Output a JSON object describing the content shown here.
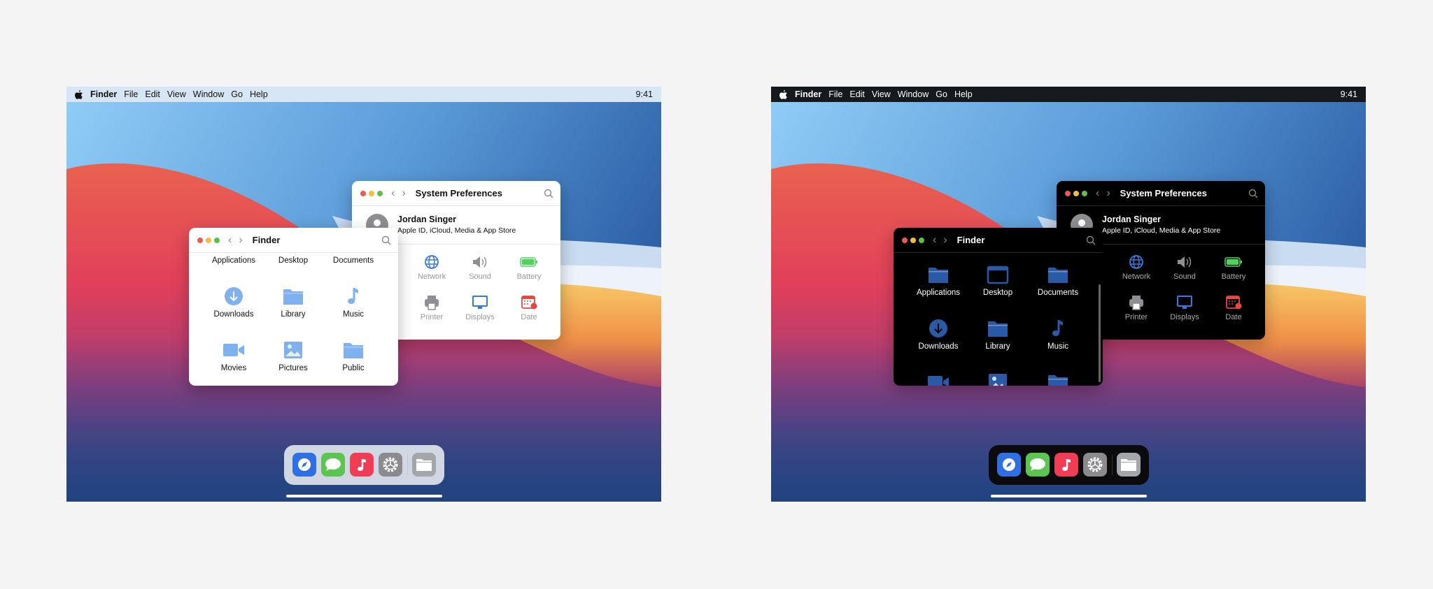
{
  "menubar": {
    "apple": "apple-logo",
    "items": [
      "Finder",
      "File",
      "Edit",
      "View",
      "Window",
      "Go",
      "Help"
    ],
    "clock": "9:41"
  },
  "system_preferences": {
    "title": "System Preferences",
    "profile": {
      "name": "Jordan Singer",
      "subtitle": "Apple ID, iCloud, Media & App Store"
    },
    "items": [
      {
        "label": "Network",
        "icon": "globe",
        "color": "#3a7be0"
      },
      {
        "label": "Sound",
        "icon": "speaker",
        "color": "#8e8e93"
      },
      {
        "label": "Battery",
        "icon": "battery",
        "color": "#4cd55a"
      },
      {
        "label": "Printer",
        "icon": "printer",
        "color": "#8e8e93"
      },
      {
        "label": "Displays",
        "icon": "display",
        "color": "#2f7ae5"
      },
      {
        "label": "Date",
        "icon": "calendar",
        "color": "#e5483f"
      }
    ]
  },
  "finder": {
    "title": "Finder",
    "items": [
      {
        "label": "Applications",
        "icon": "folder"
      },
      {
        "label": "Desktop",
        "icon": "window"
      },
      {
        "label": "Documents",
        "icon": "folder"
      },
      {
        "label": "Downloads",
        "icon": "download"
      },
      {
        "label": "Library",
        "icon": "folder"
      },
      {
        "label": "Music",
        "icon": "music"
      },
      {
        "label": "Movies",
        "icon": "video"
      },
      {
        "label": "Pictures",
        "icon": "photo"
      },
      {
        "label": "Public",
        "icon": "folder"
      }
    ]
  },
  "dock": {
    "apps": [
      {
        "name": "safari",
        "color": "#2f6fe4"
      },
      {
        "name": "messages",
        "color": "#5cc451"
      },
      {
        "name": "music",
        "color": "#ef3d55"
      },
      {
        "name": "settings",
        "color": "#8b8b8f"
      },
      {
        "name": "files",
        "color": "#a3a6ab"
      }
    ]
  },
  "themes": {
    "light": {
      "icon": "#7fb0f0"
    },
    "dark": {
      "icon": "#2a5aa6"
    }
  }
}
